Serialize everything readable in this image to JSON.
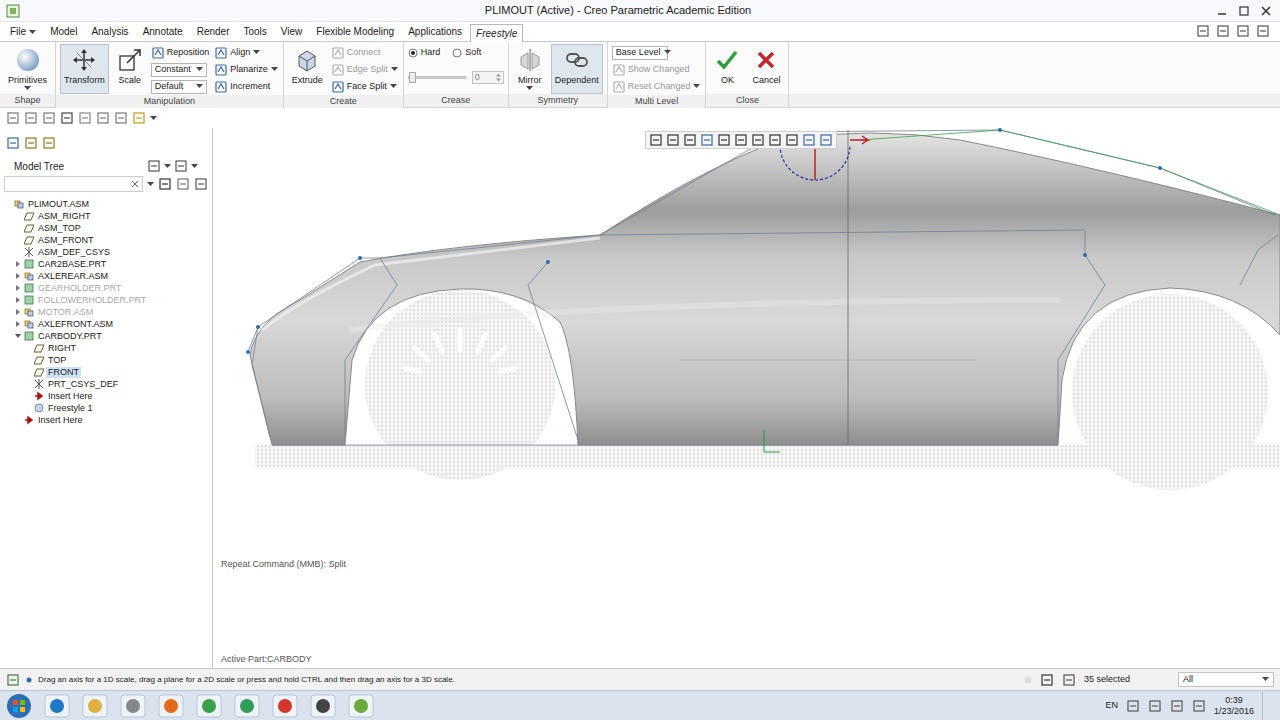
{
  "window": {
    "title": "PLIMOUT (Active) - Creo Parametric Academic Edition"
  },
  "menu_tabs": [
    {
      "label": "File",
      "selected": false,
      "has_menu": true
    },
    {
      "label": "Model",
      "selected": false,
      "has_menu": false
    },
    {
      "label": "Analysis",
      "selected": false,
      "has_menu": false
    },
    {
      "label": "Annotate",
      "selected": false,
      "has_menu": false
    },
    {
      "label": "Render",
      "selected": false,
      "has_menu": false
    },
    {
      "label": "Tools",
      "selected": false,
      "has_menu": false
    },
    {
      "label": "View",
      "selected": false,
      "has_menu": false
    },
    {
      "label": "Flexible Modeling",
      "selected": false,
      "has_menu": false
    },
    {
      "label": "Applications",
      "selected": false,
      "has_menu": false
    },
    {
      "label": "Freestyle",
      "selected": true,
      "has_menu": false
    }
  ],
  "ribbon": {
    "groups": [
      {
        "label": "Shape",
        "columns": [
          [
            {
              "kind": "large",
              "label": "Primitives",
              "selected": false,
              "disabled": false,
              "has_menu": true
            }
          ]
        ]
      },
      {
        "label": "Manipulation",
        "columns": [
          [
            {
              "kind": "large",
              "label": "Transform",
              "selected": true,
              "disabled": false,
              "has_menu": false
            }
          ],
          [
            {
              "kind": "large",
              "label": "Scale",
              "selected": false,
              "disabled": false,
              "has_menu": false
            }
          ],
          [
            {
              "kind": "small",
              "label": "Reposition",
              "selected": false,
              "disabled": false,
              "has_menu": false
            },
            {
              "kind": "dropdown",
              "label": "Constant",
              "selected": false,
              "disabled": false,
              "has_menu": true
            },
            {
              "kind": "dropdown",
              "label": "Default",
              "selected": false,
              "disabled": false,
              "has_menu": true
            }
          ],
          [
            {
              "kind": "small",
              "label": "Align",
              "selected": false,
              "disabled": false,
              "has_menu": true
            },
            {
              "kind": "small",
              "label": "Planarize",
              "selected": false,
              "disabled": false,
              "has_menu": true
            },
            {
              "kind": "small",
              "label": "Increment",
              "selected": false,
              "disabled": false,
              "has_menu": false
            }
          ]
        ]
      },
      {
        "label": "Create",
        "columns": [
          [
            {
              "kind": "large",
              "label": "Extrude",
              "selected": false,
              "disabled": false,
              "has_menu": false
            }
          ],
          [
            {
              "kind": "small",
              "label": "Connect",
              "selected": false,
              "disabled": true,
              "has_menu": false
            },
            {
              "kind": "small",
              "label": "Edge Split",
              "selected": false,
              "disabled": true,
              "has_menu": true
            },
            {
              "kind": "small",
              "label": "Face Split",
              "selected": false,
              "disabled": false,
              "has_menu": true
            }
          ]
        ]
      },
      {
        "label": "Crease",
        "columns": [
          [
            {
              "kind": "radios",
              "options": [
                {
                  "label": "Hard",
                  "selected": true
                },
                {
                  "label": "Soft",
                  "selected": false
                }
              ]
            },
            {
              "kind": "slider",
              "level": 0,
              "value": "0",
              "disabled": true
            }
          ]
        ]
      },
      {
        "label": "Symmetry",
        "columns": [
          [
            {
              "kind": "large",
              "label": "Mirror",
              "selected": false,
              "disabled": false,
              "has_menu": true
            }
          ],
          [
            {
              "kind": "large",
              "label": "Dependent",
              "selected": true,
              "disabled": false,
              "has_menu": false
            }
          ]
        ]
      },
      {
        "label": "Multi Level",
        "columns": [
          [
            {
              "kind": "dropdown",
              "label": "Base Level",
              "selected": false,
              "disabled": false,
              "has_menu": true
            },
            {
              "kind": "small",
              "label": "Show Changed",
              "selected": false,
              "disabled": true,
              "has_menu": false
            },
            {
              "kind": "small",
              "label": "Reset Changed",
              "selected": false,
              "disabled": true,
              "has_menu": true
            }
          ]
        ]
      },
      {
        "label": "Close",
        "columns": [
          [
            {
              "kind": "large",
              "label": "OK",
              "selected": false,
              "disabled": false,
              "has_menu": false
            }
          ],
          [
            {
              "kind": "large",
              "label": "Cancel",
              "selected": false,
              "disabled": false,
              "has_menu": false
            }
          ]
        ]
      }
    ]
  },
  "model_tree": {
    "title": "Model Tree",
    "items": [
      {
        "label": "PLIMOUT.ASM",
        "level": 0,
        "kind": "assembly",
        "expandable": false,
        "expanded": true,
        "disabled": false,
        "selected": false
      },
      {
        "label": "ASM_RIGHT",
        "level": 1,
        "kind": "datum-plane",
        "expandable": false,
        "expanded": false,
        "disabled": false,
        "selected": false
      },
      {
        "label": "ASM_TOP",
        "level": 1,
        "kind": "datum-plane",
        "expandable": false,
        "expanded": false,
        "disabled": false,
        "selected": false
      },
      {
        "label": "ASM_FRONT",
        "level": 1,
        "kind": "datum-plane",
        "expandable": false,
        "expanded": false,
        "disabled": false,
        "selected": false
      },
      {
        "label": "ASM_DEF_CSYS",
        "level": 1,
        "kind": "csys",
        "expandable": false,
        "expanded": false,
        "disabled": false,
        "selected": false
      },
      {
        "label": "CAR2BASE.PRT",
        "level": 1,
        "kind": "part",
        "expandable": true,
        "expanded": false,
        "disabled": false,
        "selected": false
      },
      {
        "label": "AXLEREAR.ASM",
        "level": 1,
        "kind": "assembly",
        "expandable": true,
        "expanded": false,
        "disabled": false,
        "selected": false
      },
      {
        "label": "GEARHOLDER.PRT",
        "level": 1,
        "kind": "part",
        "expandable": true,
        "expanded": false,
        "disabled": true,
        "selected": false
      },
      {
        "label": "FOLLOWERHOLDER.PRT",
        "level": 1,
        "kind": "part",
        "expandable": true,
        "expanded": false,
        "disabled": true,
        "selected": false
      },
      {
        "label": "MOTOR.ASM",
        "level": 1,
        "kind": "assembly",
        "expandable": true,
        "expanded": false,
        "disabled": true,
        "selected": false
      },
      {
        "label": "AXLEFRONT.ASM",
        "level": 1,
        "kind": "assembly",
        "expandable": true,
        "expanded": false,
        "disabled": false,
        "selected": false
      },
      {
        "label": "CARBODY.PRT",
        "level": 1,
        "kind": "part",
        "expandable": true,
        "expanded": true,
        "disabled": false,
        "selected": false
      },
      {
        "label": "RIGHT",
        "level": 2,
        "kind": "datum-plane",
        "expandable": false,
        "expanded": false,
        "disabled": false,
        "selected": false
      },
      {
        "label": "TOP",
        "level": 2,
        "kind": "datum-plane",
        "expandable": false,
        "expanded": false,
        "disabled": false,
        "selected": false
      },
      {
        "label": "FRONT",
        "level": 2,
        "kind": "datum-plane",
        "expandable": false,
        "expanded": false,
        "disabled": false,
        "selected": true
      },
      {
        "label": "PRT_CSYS_DEF",
        "level": 2,
        "kind": "csys",
        "expandable": false,
        "expanded": false,
        "disabled": false,
        "selected": false
      },
      {
        "label": "Insert Here",
        "level": 2,
        "kind": "insert",
        "expandable": false,
        "expanded": false,
        "disabled": false,
        "selected": false
      },
      {
        "label": "Freestyle 1",
        "level": 2,
        "kind": "freestyle",
        "expandable": false,
        "expanded": false,
        "disabled": false,
        "selected": false
      },
      {
        "label": "Insert Here",
        "level": 1,
        "kind": "insert",
        "expandable": false,
        "expanded": false,
        "disabled": false,
        "selected": false
      }
    ]
  },
  "graphics": {
    "repeat_command": "Repeat Command (MMB): Split",
    "active_part": "Active Part:CARBODY"
  },
  "status_bar": {
    "message": "Drag an axis for a 1D scale, drag a plane for a 2D scale or press and hold CTRL and then drag an axis for a 3D scale.",
    "selection_count": "35 selected",
    "filter": "All"
  },
  "taskbar": {
    "language": "EN",
    "time": "0:39",
    "date": "1/23/2016"
  }
}
